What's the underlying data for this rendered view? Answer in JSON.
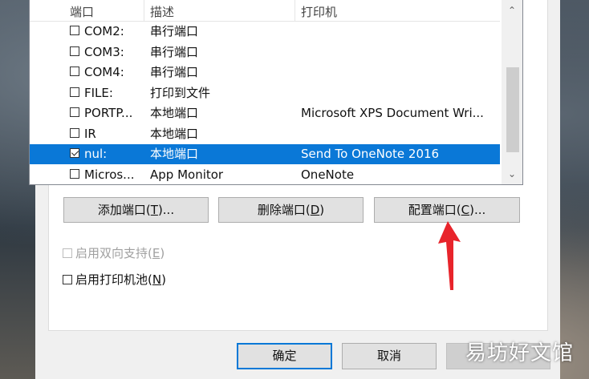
{
  "list": {
    "headers": [
      "端口",
      "描述",
      "打印机"
    ],
    "rows": [
      {
        "checked": false,
        "port": "COM2:",
        "desc": "串行端口",
        "printer": ""
      },
      {
        "checked": false,
        "port": "COM3:",
        "desc": "串行端口",
        "printer": ""
      },
      {
        "checked": false,
        "port": "COM4:",
        "desc": "串行端口",
        "printer": ""
      },
      {
        "checked": false,
        "port": "FILE:",
        "desc": "打印到文件",
        "printer": ""
      },
      {
        "checked": false,
        "port": "PORTP...",
        "desc": "本地端口",
        "printer": "Microsoft XPS Document Wri..."
      },
      {
        "checked": false,
        "port": "IR",
        "desc": "本地端口",
        "printer": ""
      },
      {
        "checked": true,
        "port": "nul:",
        "desc": "本地端口",
        "printer": "Send To OneNote 2016",
        "selected": true
      },
      {
        "checked": false,
        "port": "Micros...",
        "desc": "App Monitor",
        "printer": "OneNote"
      }
    ]
  },
  "buttons": {
    "add": {
      "label": "添加端口(",
      "key": "T",
      "suffix": ")..."
    },
    "delete": {
      "label": "删除端口(",
      "key": "D",
      "suffix": ")"
    },
    "configure": {
      "label": "配置端口(",
      "key": "C",
      "suffix": ")..."
    },
    "ok": "确定",
    "cancel": "取消"
  },
  "options": {
    "bidirectional": {
      "label": "启用双向支持(",
      "key": "E",
      "suffix": ")",
      "enabled": false,
      "checked": false
    },
    "pooling": {
      "label": "启用打印机池(",
      "key": "N",
      "suffix": ")",
      "enabled": true,
      "checked": false
    }
  },
  "watermark": "易坊好文馆",
  "colors": {
    "selection": "#0a78d7",
    "arrow": "#e8242b",
    "default_border": "#0078d7"
  },
  "icons": {
    "scroll_up": "chevron-up-icon",
    "scroll_down": "chevron-down-icon",
    "annotation": "red-arrow-icon"
  }
}
